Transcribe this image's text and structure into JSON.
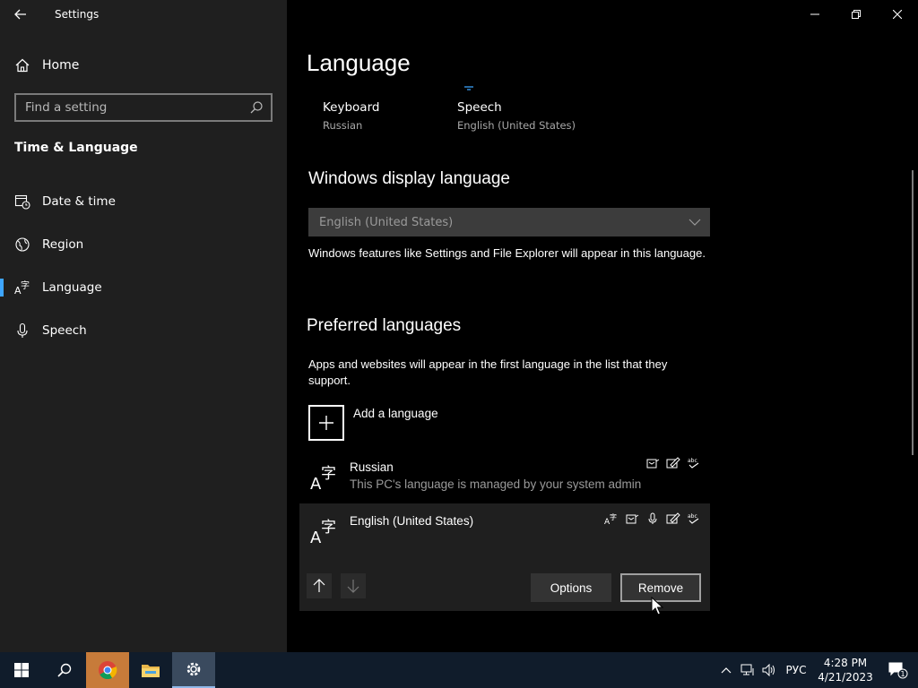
{
  "window": {
    "title": "Settings"
  },
  "sidebar": {
    "home_label": "Home",
    "search_placeholder": "Find a setting",
    "section_title": "Time & Language",
    "items": [
      {
        "label": "Date & time",
        "icon": "calendar-clock-icon"
      },
      {
        "label": "Region",
        "icon": "globe-icon"
      },
      {
        "label": "Language",
        "icon": "language-icon",
        "active": true
      },
      {
        "label": "Speech",
        "icon": "microphone-icon"
      }
    ]
  },
  "main": {
    "page_title": "Language",
    "shortcuts": [
      {
        "label": "Keyboard",
        "sub": "Russian"
      },
      {
        "label": "Speech",
        "sub": "English (United States)"
      }
    ],
    "display_language": {
      "heading": "Windows display language",
      "selected": "English (United States)",
      "description": "Windows features like Settings and File Explorer will appear in this language."
    },
    "preferred": {
      "heading": "Preferred languages",
      "description": "Apps and websites will appear in the first language in the list that they support.",
      "add_label": "Add a language",
      "languages": [
        {
          "name": "Russian",
          "note": "This PC's language is managed by your system admin"
        },
        {
          "name": "English (United States)",
          "note": ""
        }
      ],
      "options_label": "Options",
      "remove_label": "Remove"
    }
  },
  "taskbar": {
    "language_indicator": "РУС",
    "time": "4:28 PM",
    "date": "4/21/2023",
    "notification_count": "1"
  },
  "colors": {
    "accent": "#3ea6ff",
    "sidebar_bg": "#1f1f1f",
    "main_bg": "#000000",
    "taskbar_bg": "#101c2b"
  }
}
